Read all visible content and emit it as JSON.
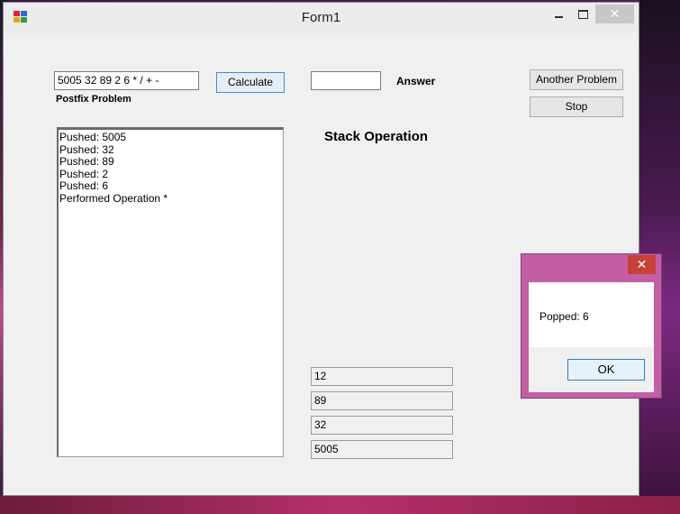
{
  "window": {
    "title": "Form1",
    "close_glyph": "✕"
  },
  "problem": {
    "input_value": "5005 32 89 2 6 * / + -",
    "label": "Postfix Problem",
    "calculate_label": "Calculate"
  },
  "answer": {
    "value": "",
    "label": "Answer"
  },
  "actions": {
    "another_label": "Another Problem",
    "stop_label": "Stop"
  },
  "stack": {
    "title": "Stack Operation",
    "items": [
      "12",
      "89",
      "32",
      "5005"
    ]
  },
  "log": {
    "lines": [
      "Pushed: 5005",
      "Pushed: 32",
      "Pushed: 89",
      "Pushed: 2",
      "Pushed: 6",
      "Performed Operation *"
    ]
  },
  "dialog": {
    "message": "Popped: 6",
    "ok_label": "OK",
    "close_glyph": "✕"
  },
  "colors": {
    "dialog_frame": "#c25fa5",
    "dialog_close": "#c7413a",
    "focus_border": "#3c8fd8"
  }
}
